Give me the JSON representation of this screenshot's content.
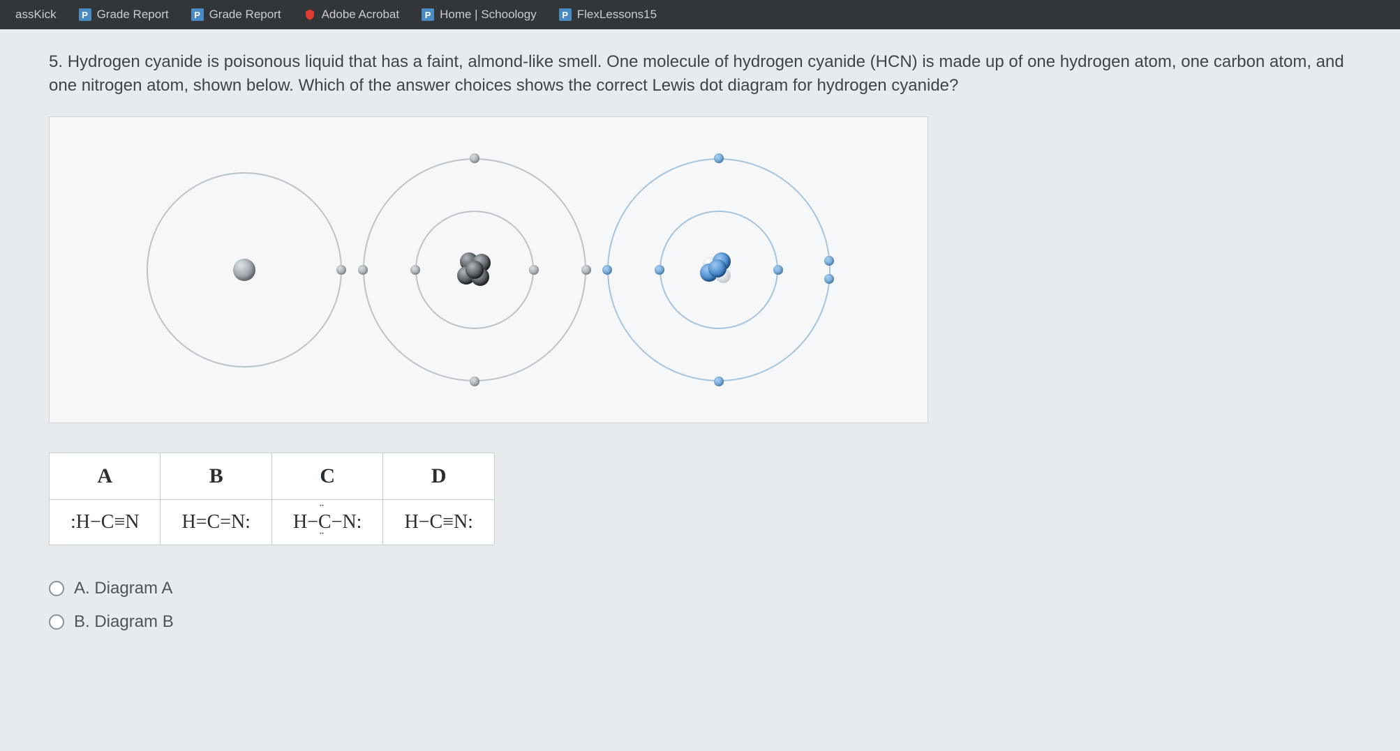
{
  "tabs": [
    {
      "label": "assKick",
      "favicon": ""
    },
    {
      "label": "Grade Report",
      "favicon": "P"
    },
    {
      "label": "Grade Report",
      "favicon": "P"
    },
    {
      "label": "Adobe Acrobat",
      "favicon": "acrobat"
    },
    {
      "label": "Home | Schoology",
      "favicon": "P"
    },
    {
      "label": "FlexLessons15",
      "favicon": "P"
    }
  ],
  "question": {
    "number": "5.",
    "text": "Hydrogen cyanide is poisonous liquid that has a faint, almond-like smell. One molecule of hydrogen cyanide (HCN) is made up of one hydrogen atom, one carbon atom, and one nitrogen atom, shown below. Which of the answer choices shows the correct Lewis dot diagram for hydrogen cyanide?"
  },
  "answer_table": {
    "headers": [
      "A",
      "B",
      "C",
      "D"
    ],
    "formulas": [
      ":H−C≡N",
      "H=C=N:",
      "H−C̈−N:",
      "H−C≡N:"
    ]
  },
  "choices": [
    {
      "label": "A. Diagram A"
    },
    {
      "label": "B. Diagram B"
    }
  ],
  "atoms": {
    "hydrogen": {
      "shells": 1,
      "electrons_outer": 1,
      "nucleus": "gray"
    },
    "carbon": {
      "shells": 2,
      "electrons_inner": 2,
      "electrons_outer": 4,
      "nucleus": "dark"
    },
    "nitrogen": {
      "shells": 2,
      "electrons_inner": 2,
      "electrons_outer": 5,
      "nucleus": "blue"
    }
  }
}
